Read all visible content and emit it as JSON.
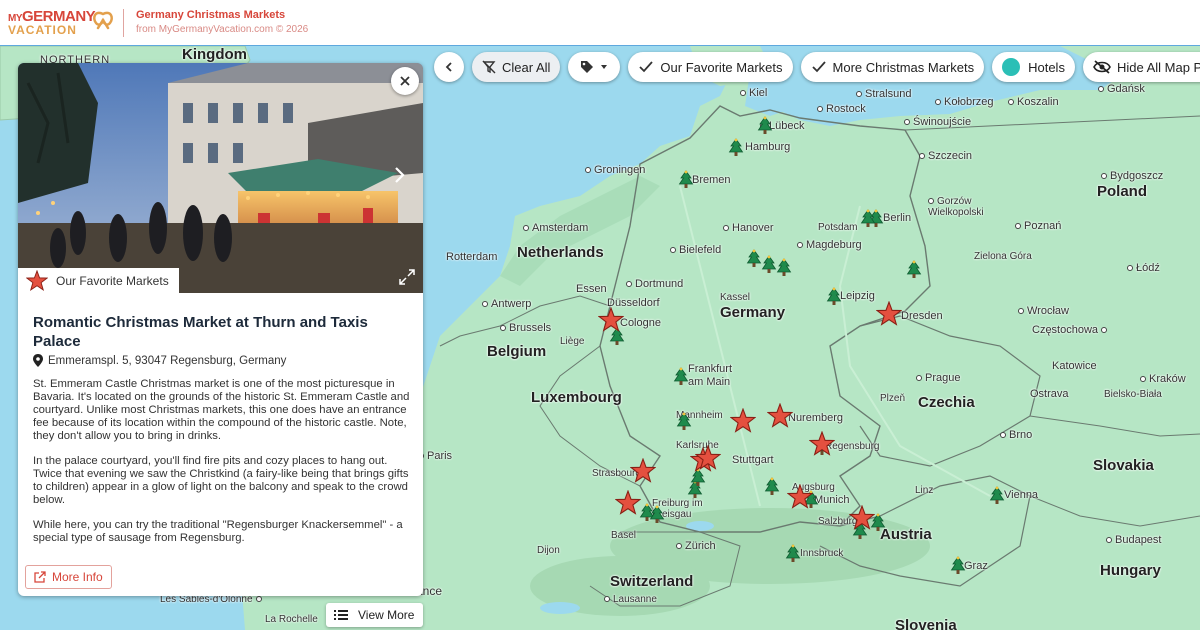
{
  "header": {
    "logo_my": "MY",
    "logo_brand": "GERMANY",
    "logo_sub": "VACATION",
    "title": "Germany Christmas Markets",
    "subtitle": "from MyGermanyVacation.com © 2026"
  },
  "toolbar": {
    "clear_all": "Clear All",
    "favorites": "Our Favorite Markets",
    "more_markets": "More Christmas Markets",
    "hotels": "Hotels",
    "hide_points": "Hide All Map Points"
  },
  "panel": {
    "badge": "Our Favorite Markets",
    "title": "Romantic Christmas Market at Thurn and Taxis Palace",
    "address": "Emmeramspl. 5, 93047 Regensburg, Germany",
    "p1": "St. Emmeram Castle Christmas market is one of the most picturesque in Bavaria.  It's located on the grounds of the historic St. Emmeram Castle and courtyard. Unlike most Christmas markets, this one does have an entrance fee because of its location within the compound of the historic castle. Note, they don't allow you to bring in drinks.",
    "p2": "In the palace courtyard, you'll find fire pits and cozy places to hang out. Twice that evening we saw the Christkind (a fairy-like being that brings gifts to children) appear in a glow of light on the balcony and speak to the crowd below.",
    "p3": "While here, you can try the traditional \"Regensburger Knackersemmel\" - a special type of sausage from Regensburg.",
    "more_info": "More Info"
  },
  "view_more": "View More",
  "map": {
    "countries": [
      "Kingdom",
      "NORTHERN",
      "Netherlands",
      "Belgium",
      "Luxembourg",
      "Germany",
      "Poland",
      "Czechia",
      "Switzerland",
      "Austria",
      "Slovakia",
      "Hungary",
      "Slovenia"
    ],
    "cities": [
      "Gdańsk",
      "Kiel",
      "Stralsund",
      "Kołobrzeg",
      "Koszalin",
      "Lübeck",
      "Rostock",
      "Świnoujście",
      "Hamburg",
      "Szczecin",
      "Bydgoszcz",
      "Groningen",
      "Bremen",
      "Gorzów Wielkopolski",
      "Amsterdam",
      "Hanover",
      "Potsdam",
      "Berlin",
      "Poznań",
      "Rotterdam",
      "Bielefeld",
      "Magdeburg",
      "Zielona Góra",
      "Łódź",
      "Essen",
      "Dortmund",
      "Antwerp",
      "Düsseldorf",
      "Kassel",
      "Leipzig",
      "Wrocław",
      "Brussels",
      "Cologne",
      "Liège",
      "Dresden",
      "Częstochowa",
      "Frankfurt am Main",
      "Prague",
      "Katowice",
      "Kraków",
      "Mannheim",
      "Nuremberg",
      "Plzeň",
      "Ostrava",
      "Bielsko-Biała",
      "Karlsruhe",
      "Regensburg",
      "Paris",
      "Stuttgart",
      "Brno",
      "Strasbourg",
      "Augsburg",
      "Linz",
      "Munich",
      "Vienna",
      "Freiburg im Breisgau",
      "Salzburg",
      "Basel",
      "Zürich",
      "Innsbruck",
      "Budapest",
      "Dijon",
      "Graz",
      "Lausanne",
      "Les Sables-d'Olonne",
      "La Rochelle"
    ]
  },
  "colors": {
    "brand_red": "#d7463a",
    "land": "#b6e6c5",
    "water": "#9cd9ee",
    "hotel_teal": "#2bbfb6"
  }
}
